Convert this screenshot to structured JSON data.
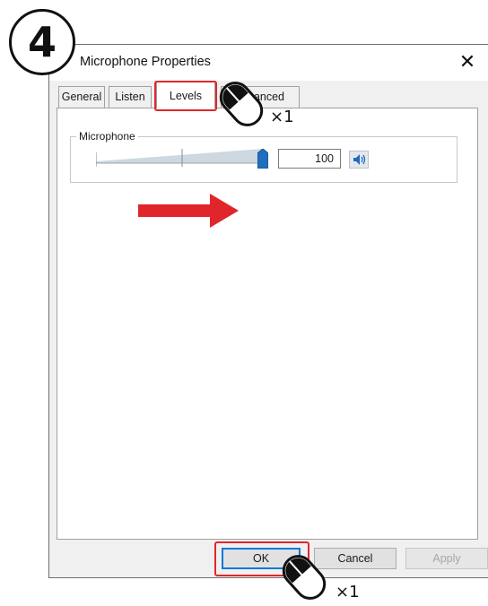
{
  "step": {
    "number": "4"
  },
  "dialog": {
    "title": "Microphone Properties",
    "close_symbol": "✕"
  },
  "tabs": [
    {
      "label": "General",
      "active": false
    },
    {
      "label": "Listen",
      "active": false
    },
    {
      "label": "Levels",
      "active": true
    },
    {
      "label": "anced",
      "active": false
    }
  ],
  "levels": {
    "group_label": "Microphone",
    "value": "100",
    "level_fraction": 1.0,
    "speaker_icon": "speaker-icon"
  },
  "buttons": {
    "ok": "OK",
    "cancel": "Cancel",
    "apply": "Apply"
  },
  "annotations": {
    "tab_click_count": "×1",
    "ok_click_count": "×1",
    "highlight_color": "#e0262b",
    "arrow_color": "#e0262b"
  }
}
